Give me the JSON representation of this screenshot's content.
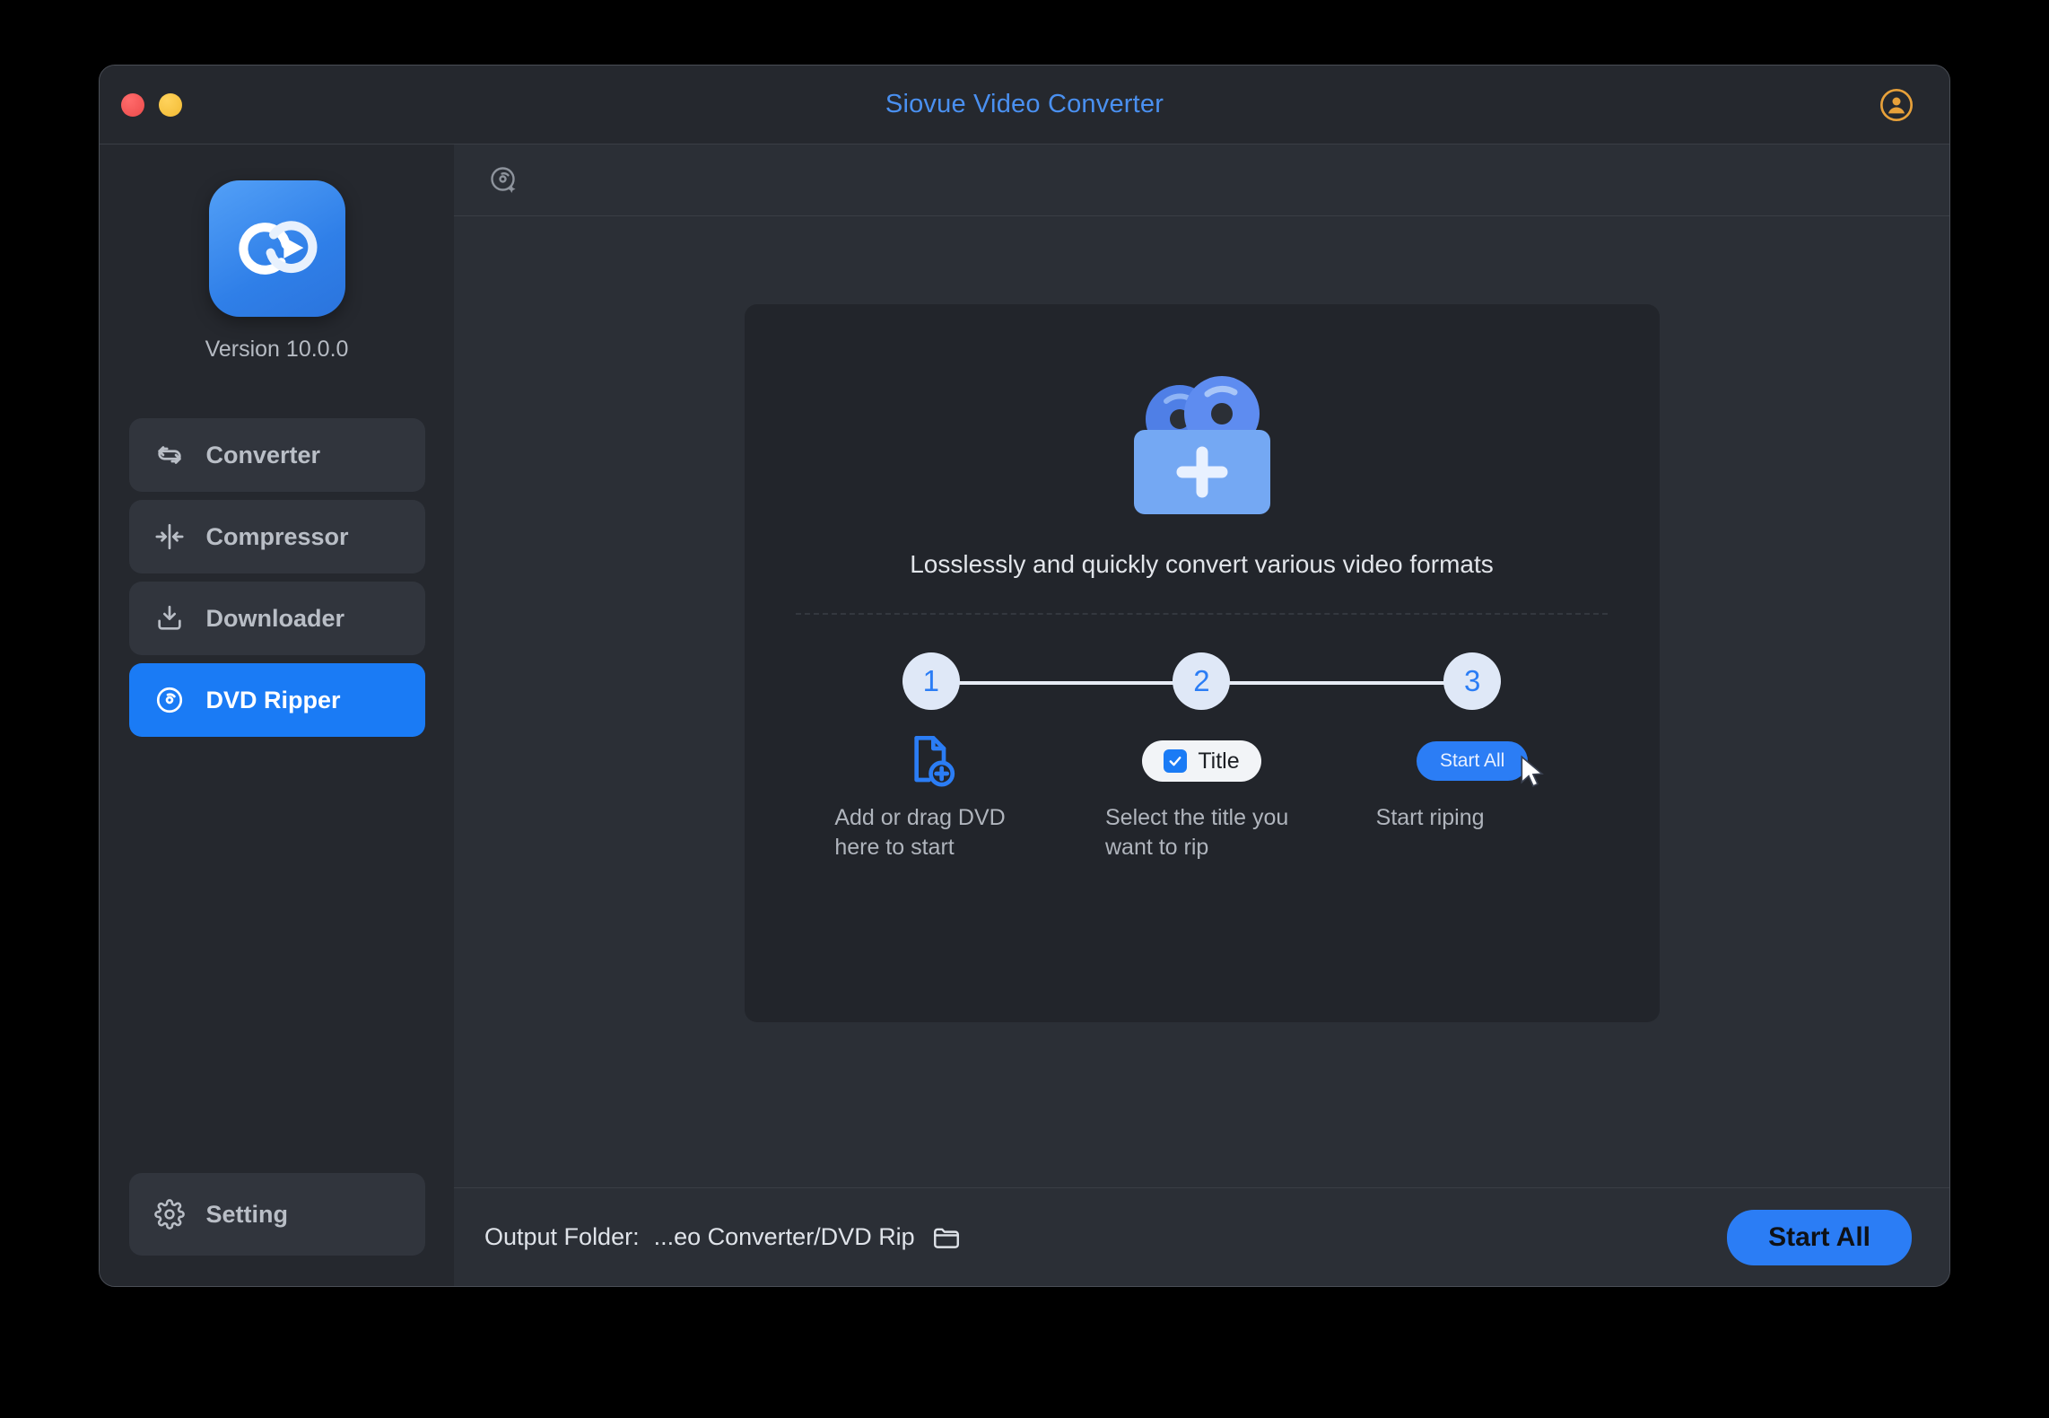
{
  "window": {
    "title": "Siovue Video Converter",
    "traffic_lights": [
      "close-button",
      "minimize-button"
    ],
    "account_icon": "account-circle-icon"
  },
  "sidebar": {
    "app_icon": "siovue-app-icon",
    "version": "Version 10.0.0",
    "items": [
      {
        "label": "Converter",
        "icon": "loop-arrows-icon",
        "active": false
      },
      {
        "label": "Compressor",
        "icon": "compress-arrows-icon",
        "active": false
      },
      {
        "label": "Downloader",
        "icon": "download-tray-icon",
        "active": false
      },
      {
        "label": "DVD Ripper",
        "icon": "disc-icon",
        "active": true
      }
    ],
    "setting": {
      "label": "Setting",
      "icon": "gear-icon"
    }
  },
  "toolbar": {
    "add_dvd_icon": "add-disc-icon"
  },
  "empty_state": {
    "illustration": "dvd-discs-in-box-plus-icon",
    "tagline": "Losslessly and quickly convert various video formats",
    "steps": [
      {
        "number": "1",
        "icon": "file-add-icon",
        "caption": "Add or drag DVD here to start"
      },
      {
        "number": "2",
        "icon": "title-checkbox-pill",
        "pill_label": "Title",
        "caption": "Select the title you want to rip"
      },
      {
        "number": "3",
        "icon": "start-all-pill",
        "pill_label": "Start All",
        "caption": "Start riping",
        "cursor": "mouse-cursor-icon"
      }
    ]
  },
  "bottom_bar": {
    "output_label": "Output Folder:",
    "output_path": "...eo Converter/DVD Rip",
    "folder_icon": "folder-icon",
    "start_all_label": "Start All"
  },
  "colors": {
    "accent_blue": "#1a7bf5",
    "title_blue": "#4a90f0",
    "window_bg": "#2b2f36",
    "sidebar_bg": "#25282e",
    "panel_bg": "#22252b",
    "account_orange": "#e8a13a",
    "close_red": "#ec4b4b",
    "minimize_yellow": "#f2ba33"
  }
}
